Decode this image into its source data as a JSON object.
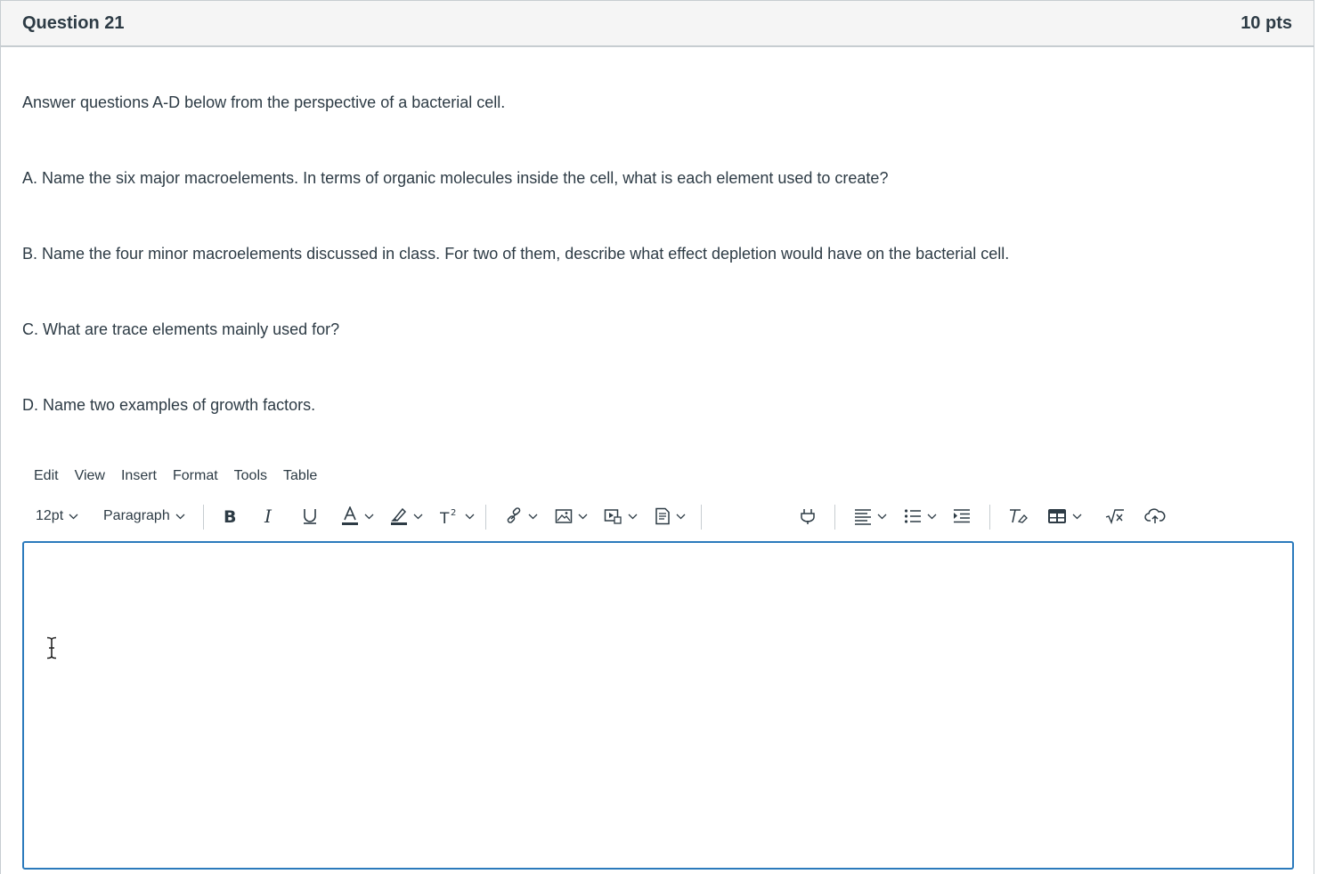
{
  "question": {
    "title": "Question 21",
    "points": "10 pts",
    "intro": "Answer questions A-D below from the perspective of a bacterial cell.",
    "parts": [
      "A. Name the six major macroelements. In terms of organic molecules inside the cell, what is each element used to create?",
      "B. Name the four minor macroelements discussed in class. For two of them, describe what effect depletion would have on the bacterial cell.",
      "C. What are trace elements mainly used for?",
      "D. Name two examples of growth factors."
    ]
  },
  "editor": {
    "menu": [
      "Edit",
      "View",
      "Insert",
      "Format",
      "Tools",
      "Table"
    ],
    "font_size": "12pt",
    "block_format": "Paragraph",
    "toolbar_icons": [
      "bold-icon",
      "italic-icon",
      "underline-icon",
      "text-color-icon",
      "highlight-icon",
      "superscript-icon",
      "link-icon",
      "image-icon",
      "media-icon",
      "document-icon",
      "plugin-icon",
      "align-icon",
      "bullet-list-icon",
      "indent-icon",
      "clear-formatting-icon",
      "table-icon",
      "math-equation-icon",
      "cloud-upload-icon"
    ],
    "content": ""
  },
  "colors": {
    "focus_border": "#2b7abc",
    "header_bg": "#f5f5f5",
    "text": "#2d3b45",
    "border": "#c7cdd1"
  }
}
